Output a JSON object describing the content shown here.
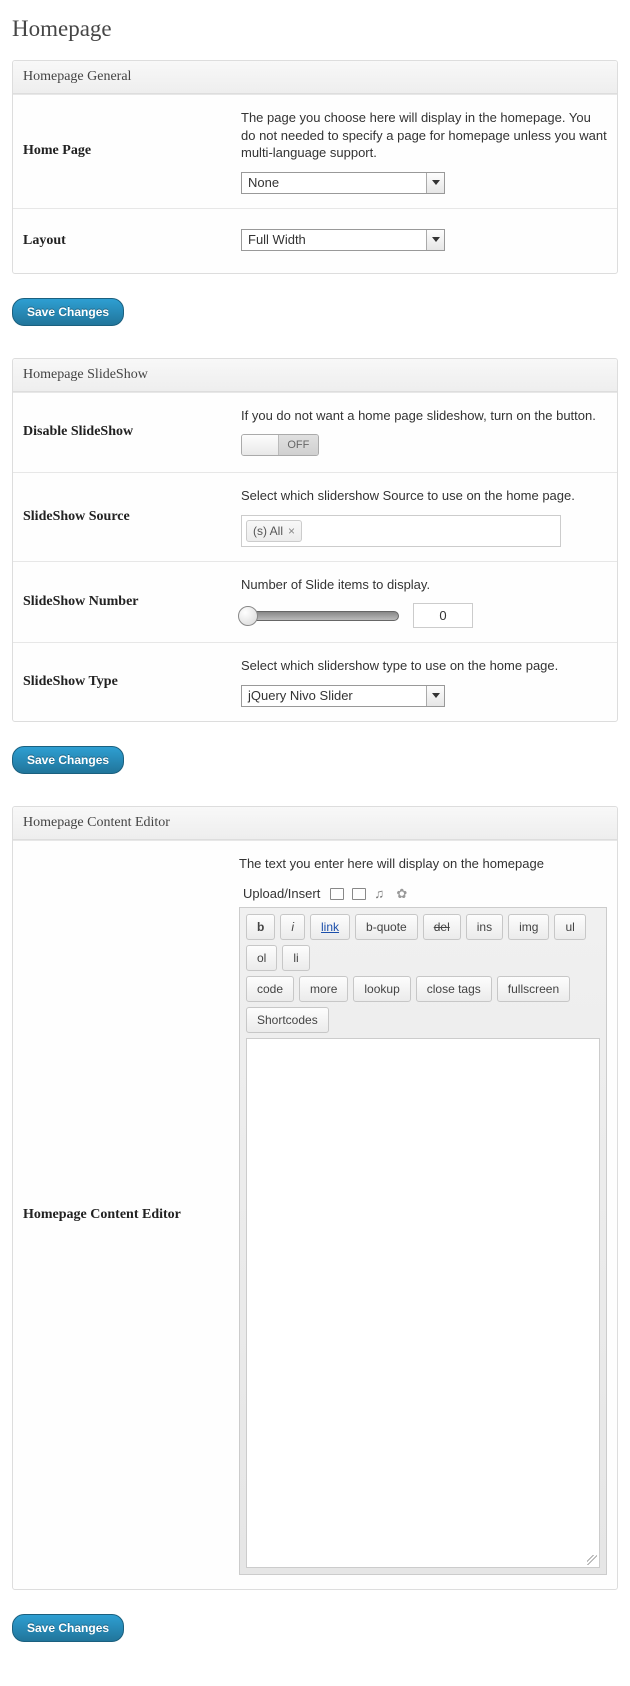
{
  "page_title": "Homepage",
  "save_label": "Save Changes",
  "panels": {
    "general": {
      "title": "Homepage General",
      "home_page": {
        "label": "Home Page",
        "desc": "The page you choose here will display in the homepage. You do not needed to specify a page for homepage unless you want multi-language support.",
        "value": "None"
      },
      "layout": {
        "label": "Layout",
        "value": "Full Width"
      }
    },
    "slideshow": {
      "title": "Homepage SlideShow",
      "disable": {
        "label": "Disable SlideShow",
        "desc": "If you do not want a home page slideshow, turn on the button.",
        "state": "OFF"
      },
      "source": {
        "label": "SlideShow Source",
        "desc": "Select which slidershow Source to use on the home page.",
        "tag": "(s) All"
      },
      "number": {
        "label": "SlideShow Number",
        "desc": "Number of Slide items to display.",
        "value": "0"
      },
      "type": {
        "label": "SlideShow Type",
        "desc": "Select which slidershow type to use on the home page.",
        "value": "jQuery Nivo Slider"
      }
    },
    "editor": {
      "title": "Homepage Content Editor",
      "label": "Homepage Content Editor",
      "desc": "The text you enter here will display on the homepage",
      "upload_label": "Upload/Insert",
      "buttons": {
        "b": "b",
        "i": "i",
        "link": "link",
        "bquote": "b-quote",
        "del": "del",
        "ins": "ins",
        "img": "img",
        "ul": "ul",
        "ol": "ol",
        "li": "li",
        "code": "code",
        "more": "more",
        "lookup": "lookup",
        "close": "close tags",
        "fullscreen": "fullscreen",
        "shortcodes": "Shortcodes"
      }
    }
  }
}
